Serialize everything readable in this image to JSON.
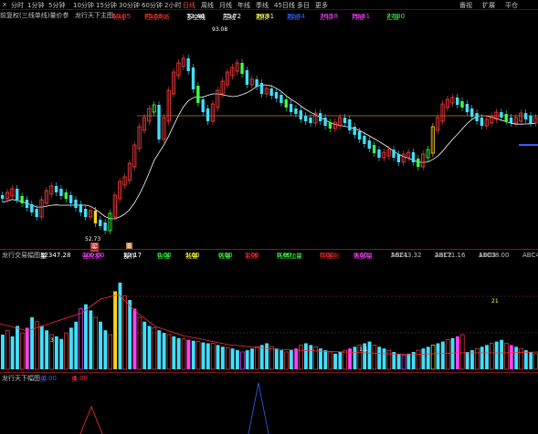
{
  "toolbar": {
    "items": [
      "分时",
      "1分钟",
      "5分钟",
      "10分钟",
      "15分钟",
      "30分钟",
      "60分钟",
      "2小时",
      "日线",
      "周线",
      "月线",
      "年线",
      "季线",
      "45日线",
      "多日",
      "更多"
    ],
    "active": "日线",
    "right_items": [
      "番视",
      "扩展",
      "平仓"
    ],
    "close_label": "×"
  },
  "main_header": {
    "title": "前复权(三线单线)量价参",
    "indicator_name": "龙行天下主图",
    "fields": [
      {
        "label": "长线",
        "value": "59.05",
        "color": "#ff3030"
      },
      {
        "label": "短线判断",
        "value": "75.53",
        "color": "#ff3030"
      },
      {
        "label": "多空线",
        "value": "73.46",
        "color": "#ffffff"
      },
      {
        "label": "压线",
        "value": "75.72",
        "color": "#ffffff"
      },
      {
        "label": "箱顶",
        "value": "79.81",
        "color": "#ffff40"
      },
      {
        "label": "箱底",
        "value": "72.34",
        "color": "#3060ff"
      },
      {
        "label": "止损",
        "value": "76.38",
        "color": "#ff40ff"
      },
      {
        "label": "持股",
        "value": "79.61",
        "color": "#ff40ff"
      },
      {
        "label": "止盈",
        "value": "77.00",
        "color": "#40ff40"
      }
    ],
    "high_label": "93.08",
    "low_label": "52.73",
    "buy_marker": "买",
    "buy_marker2": "B"
  },
  "vol_header": {
    "title": "龙行交易幅图",
    "fields": [
      {
        "label": "量",
        "value": "32347.28",
        "color": "#ffffff"
      },
      {
        "label": "强化额",
        "value": "100.00",
        "color": "#ff40ff"
      },
      {
        "label": "操作",
        "value": "12.17",
        "color": "#ffffff"
      },
      {
        "label": "自强",
        "value": "0.00",
        "color": "#40ff40"
      },
      {
        "label": "钱量",
        "value": "1.00",
        "color": "#ffff40"
      },
      {
        "label": "钱量",
        "value": "0.00",
        "color": "#40ff40"
      },
      {
        "label": "紧随",
        "value": "1.00",
        "color": "#ff3030"
      },
      {
        "label": "托势加量",
        "value": "0.00",
        "color": "#40ff40"
      },
      {
        "label": "顶强则",
        "value": "0.00",
        "color": "#ff3030"
      },
      {
        "label": "底部量",
        "value": "0.00",
        "color": "#ff40ff"
      },
      {
        "label": "ABC1",
        "value": "56243.32",
        "color": "#c0c0c0"
      },
      {
        "label": "ABC2",
        "value": "28171.16",
        "color": "#c0c0c0"
      },
      {
        "label": "ABC3",
        "value": "11008.00",
        "color": "#c0c0c0"
      },
      {
        "label": "ABC4",
        "value": "",
        "color": "#c0c0c0"
      }
    ],
    "peak_label": "21",
    "mark_1": "3",
    "mark_2": "1:1"
  },
  "bottom_header": {
    "title": "龙行天下幅图",
    "fields": [
      {
        "label": "买",
        "value": "0.00",
        "color": "#3060ff"
      },
      {
        "label": "卖",
        "value": "1.00",
        "color": "#ff3030"
      }
    ]
  }
}
